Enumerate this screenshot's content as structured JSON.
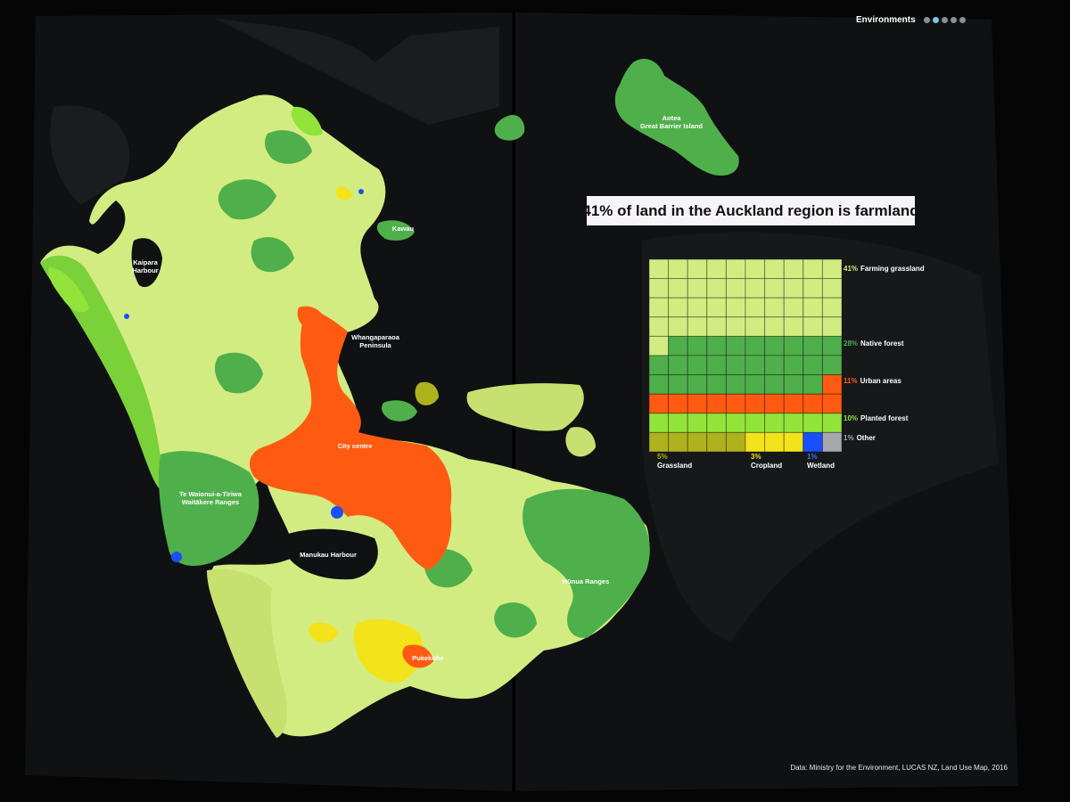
{
  "nav": {
    "title": "Environments",
    "dots": 5,
    "active_index": 1
  },
  "headline": "41% of land in the Auckland region is farmland",
  "map_labels": {
    "kaipara": "Kaipara\nHarbour",
    "kawau": "Kawau",
    "whangaparaoa": "Whangaparaoa\nPeninsula",
    "aotea": "Aotea\nGreat Barrier Island",
    "city": "City centre",
    "waitakere": "Te Waionui-a-Tiriwa\nWaitākere Ranges",
    "manukau": "Manukau Harbour",
    "hunua": "Hūnua Ranges",
    "pukekohe": "Pukekohe"
  },
  "colors": {
    "farming_grassland": "#d3ec82",
    "native_forest": "#4fb04b",
    "urban": "#ff5a12",
    "planted_forest": "#92e43a",
    "grassland": "#aeb21c",
    "cropland": "#f3e31a",
    "wetland": "#1a4fff",
    "other": "#a7a7ae"
  },
  "chart_data": {
    "type": "waffle",
    "grid": [
      10,
      10
    ],
    "title": "41% of land in the Auckland region is farmland",
    "categories": [
      {
        "key": "farming_grassland",
        "label": "Farming grassland",
        "pct_label": "41%",
        "value": 41
      },
      {
        "key": "native_forest",
        "label": "Native forest",
        "pct_label": "28%",
        "value": 28
      },
      {
        "key": "urban",
        "label": "Urban areas",
        "pct_label": "11%",
        "value": 11
      },
      {
        "key": "planted_forest",
        "label": "Planted forest",
        "pct_label": "10%",
        "value": 10
      },
      {
        "key": "grassland",
        "label": "Grassland",
        "pct_label": "5%",
        "value": 5
      },
      {
        "key": "cropland",
        "label": "Cropland",
        "pct_label": "3%",
        "value": 3
      },
      {
        "key": "wetland",
        "label": "Wetland",
        "pct_label": "1%",
        "value": 1
      },
      {
        "key": "other",
        "label": "Other",
        "pct_label": "1%",
        "value": 1
      }
    ]
  },
  "source": "Data: Ministry for the Environment, LUCAS NZ, Land Use Map, 2016"
}
